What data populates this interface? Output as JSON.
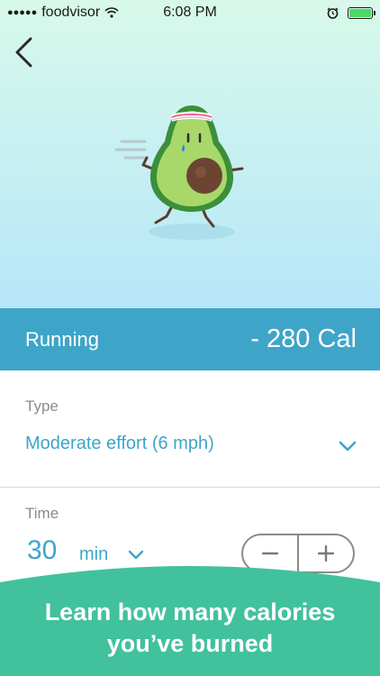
{
  "status_bar": {
    "carrier": "foodvisor",
    "time": "6:08 PM"
  },
  "icons": {
    "back": "chevron-left-icon",
    "wifi": "wifi-icon",
    "alarm": "alarm-icon",
    "battery": "battery-icon",
    "mascot": "avocado-running-icon",
    "dropdown": "chevron-down-icon",
    "minus": "minus-icon",
    "plus": "plus-icon"
  },
  "activity": {
    "name": "Running",
    "calories": "- 280 Cal"
  },
  "type": {
    "label": "Type",
    "value": "Moderate effort (6 mph)"
  },
  "time": {
    "label": "Time",
    "value": "30",
    "unit": "min"
  },
  "banner": {
    "line1": "Learn how many calories",
    "line2": "you’ve burned"
  },
  "colors": {
    "accent": "#3ea5c8",
    "banner": "#41c29c",
    "hero_top": "#d8f9ea",
    "hero_bottom": "#b6e6f8"
  }
}
